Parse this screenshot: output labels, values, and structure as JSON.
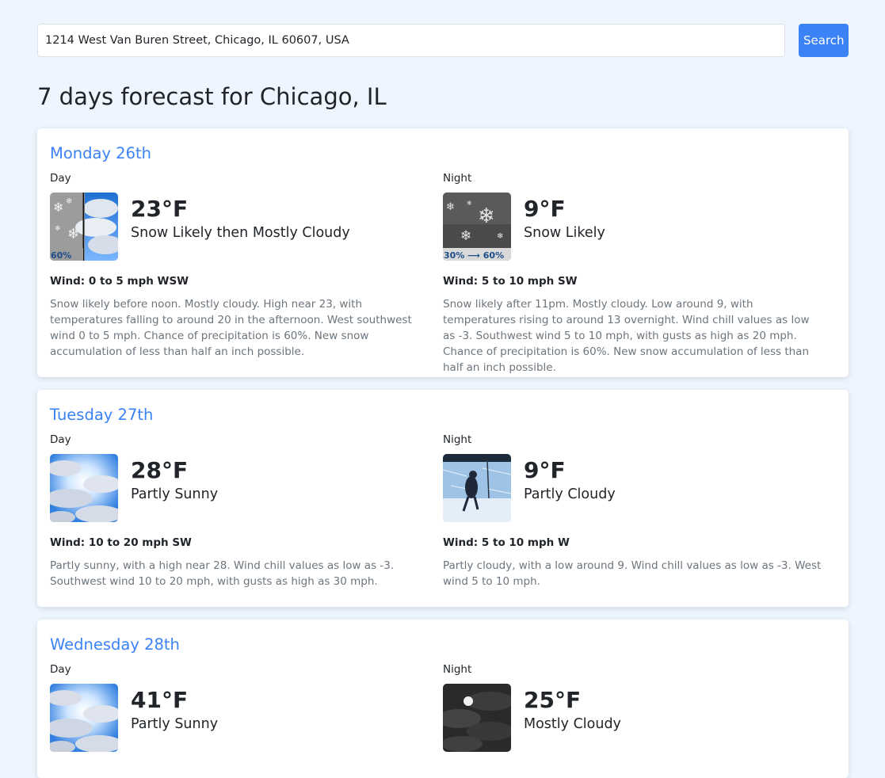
{
  "search": {
    "value": "1214 West Van Buren Street, Chicago, IL 60607, USA",
    "button_label": "Search"
  },
  "page_title": "7 days forecast for Chicago, IL",
  "days": [
    {
      "title": "Monday 26th",
      "day": {
        "label": "Day",
        "temp": "23°F",
        "short": "Snow Likely then Mostly Cloudy",
        "wind": "Wind: 0 to 5 mph WSW",
        "detail": "Snow likely before noon. Mostly cloudy. High near 23, with temperatures falling to around 20 in the afternoon. West southwest wind 0 to 5 mph. Chance of precipitation is 60%. New snow accumulation of less than half an inch possible.",
        "icon": "snow-then-cloudy-icon",
        "icon_text": "60%"
      },
      "night": {
        "label": "Night",
        "temp": "9°F",
        "short": "Snow Likely",
        "wind": "Wind: 5 to 10 mph SW",
        "detail": "Snow likely after 11pm. Mostly cloudy. Low around 9, with temperatures rising to around 13 overnight. Wind chill values as low as -3. Southwest wind 5 to 10 mph, with gusts as high as 20 mph. Chance of precipitation is 60%. New snow accumulation of less than half an inch possible.",
        "icon": "snow-night-icon",
        "icon_text": "30% ⟶ 60%"
      }
    },
    {
      "title": "Tuesday 27th",
      "day": {
        "label": "Day",
        "temp": "28°F",
        "short": "Partly Sunny",
        "wind": "Wind: 10 to 20 mph SW",
        "detail": "Partly sunny, with a high near 28. Wind chill values as low as -3. Southwest wind 10 to 20 mph, with gusts as high as 30 mph.",
        "icon": "partly-sunny-icon"
      },
      "night": {
        "label": "Night",
        "temp": "9°F",
        "short": "Partly Cloudy",
        "wind": "Wind: 5 to 10 mph W",
        "detail": "Partly cloudy, with a low around 9. Wind chill values as low as -3. West wind 5 to 10 mph.",
        "icon": "windy-cold-icon"
      }
    },
    {
      "title": "Wednesday 28th",
      "day": {
        "label": "Day",
        "temp": "41°F",
        "short": "Partly Sunny",
        "icon": "partly-sunny-icon"
      },
      "night": {
        "label": "Night",
        "temp": "25°F",
        "short": "Mostly Cloudy",
        "icon": "mostly-cloudy-night-icon"
      }
    }
  ],
  "colors": {
    "background": "#eef5ff",
    "accent": "#3b82f6",
    "muted_text": "#6c757d"
  }
}
